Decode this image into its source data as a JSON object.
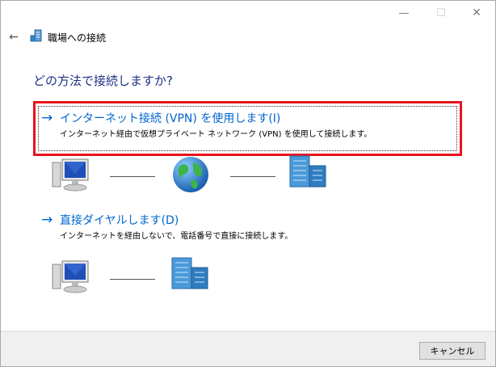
{
  "window": {
    "controls": {
      "minimize": "—",
      "maximize": "☐",
      "close": "✕"
    }
  },
  "header": {
    "back_icon": "←",
    "title": "職場への接続"
  },
  "question": "どの方法で接続しますか?",
  "options": [
    {
      "arrow": "→",
      "title": "インターネット接続 (VPN) を使用します(I)",
      "description": "インターネット経由で仮想プライベート ネットワーク (VPN) を使用して接続します。",
      "diagram": [
        "computer-icon",
        "globe-icon",
        "building-icon"
      ]
    },
    {
      "arrow": "→",
      "title": "直接ダイヤルします(D)",
      "description": "インターネットを経由しないで、電話番号で直接に接続します。",
      "diagram": [
        "computer-icon",
        "building-icon"
      ]
    }
  ],
  "footer": {
    "cancel_label": "キャンセル"
  },
  "colors": {
    "accent": "#0066cc",
    "heading": "#1e3287",
    "highlight": "#e8131c"
  }
}
